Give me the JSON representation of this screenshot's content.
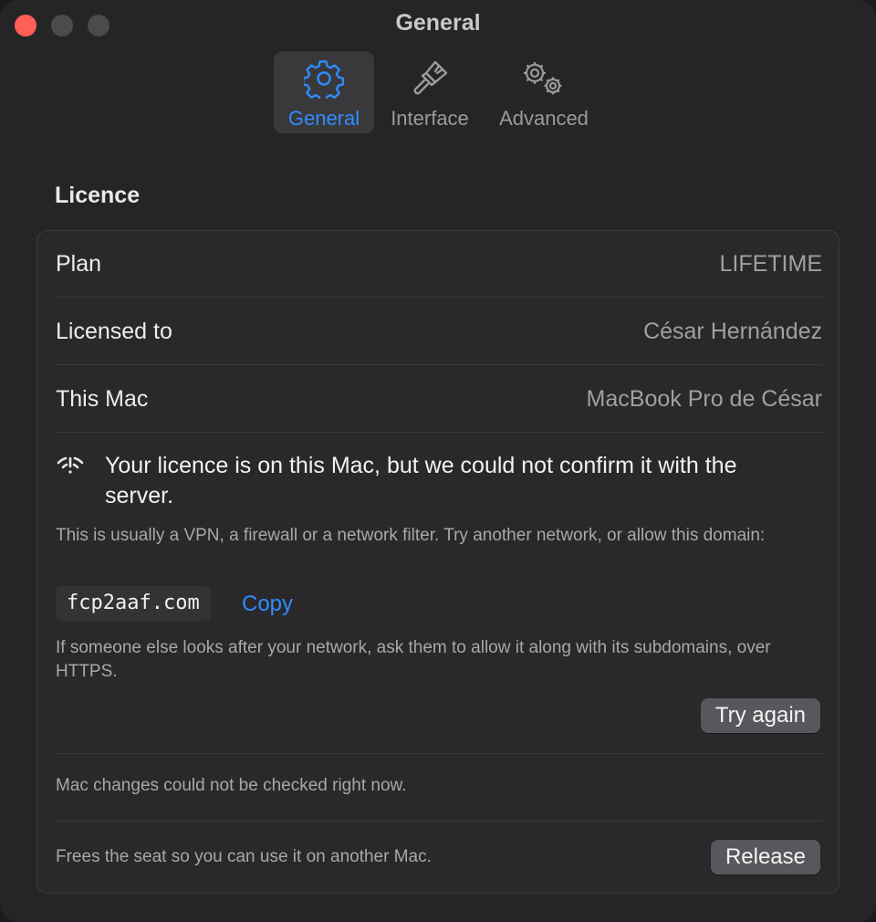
{
  "window": {
    "title": "General"
  },
  "toolbar": {
    "tabs": [
      {
        "label": "General",
        "icon": "gear-icon",
        "active": true
      },
      {
        "label": "Interface",
        "icon": "paintbrush-icon",
        "active": false
      },
      {
        "label": "Advanced",
        "icon": "gears-icon",
        "active": false
      }
    ]
  },
  "licence": {
    "section_title": "Licence",
    "rows": [
      {
        "label": "Plan",
        "value": "LIFETIME"
      },
      {
        "label": "Licensed to",
        "value": "César Hernández"
      },
      {
        "label": "This Mac",
        "value": "MacBook Pro de César"
      }
    ],
    "warning": {
      "icon": "wifi-exclamation-icon",
      "title": "Your licence is on this Mac, but we could not confirm it with the server.",
      "description": "This is usually a VPN, a firewall or a network filter. Try another network, or allow this domain:",
      "domain": "fcp2aaf.com",
      "copy_label": "Copy",
      "note": "If someone else looks after your network, ask them to allow it along with its subdomains, over HTTPS.",
      "try_again_label": "Try again"
    },
    "mac_status": "Mac changes could not be checked right now.",
    "release": {
      "description": "Frees the seat so you can use it on another Mac.",
      "button_label": "Release"
    }
  },
  "colors": {
    "accent": "#2f8cff",
    "close": "#fe5f57",
    "background": "#252527"
  }
}
